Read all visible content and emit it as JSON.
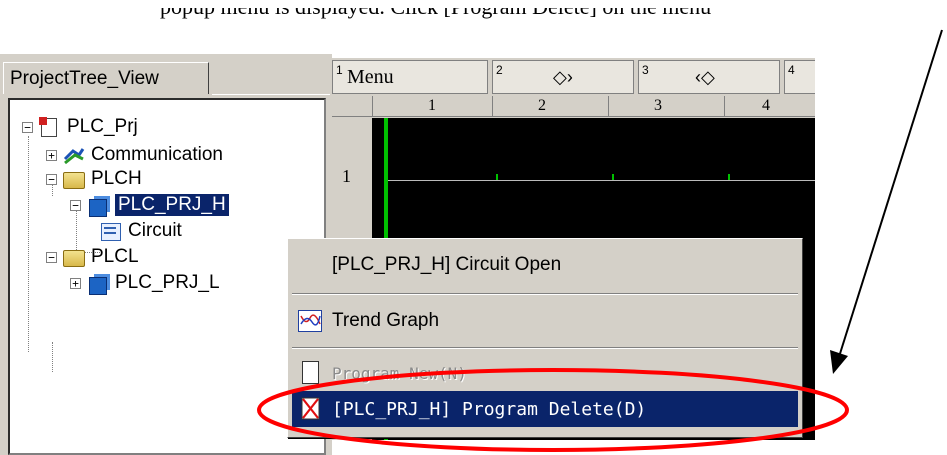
{
  "caption": "popup menu is displayed. Click [Program Delete] on the menu",
  "tree_panel": {
    "tab_label": "ProjectTree_View",
    "nodes": {
      "root": "PLC_Prj",
      "communication": "Communication",
      "plch": "PLCH",
      "plc_prj_h": "PLC_PRJ_H",
      "circuit": "Circuit",
      "plcl": "PLCL",
      "plc_prj_l": "PLC_PRJ_L"
    },
    "expanders": {
      "minus": "−",
      "plus": "+"
    }
  },
  "editor": {
    "header_tabs": [
      {
        "num": "1",
        "label": "Menu"
      },
      {
        "num": "2",
        "label": "◇›"
      },
      {
        "num": "3",
        "label": "‹◇"
      },
      {
        "num": "4",
        "label": ""
      }
    ],
    "ruler": [
      "1",
      "2",
      "3",
      "4"
    ],
    "row_number": "1"
  },
  "context_menu": {
    "items": {
      "circuit_open": "[PLC_PRJ_H] Circuit Open",
      "trend_graph": "Trend Graph",
      "program_new": "Program New(N)",
      "program_delete": "[PLC_PRJ_H] Program Delete(D)"
    }
  },
  "colors": {
    "highlight": "#0a246a",
    "annotation": "#ff0000",
    "ladder_rail": "#00c000"
  }
}
